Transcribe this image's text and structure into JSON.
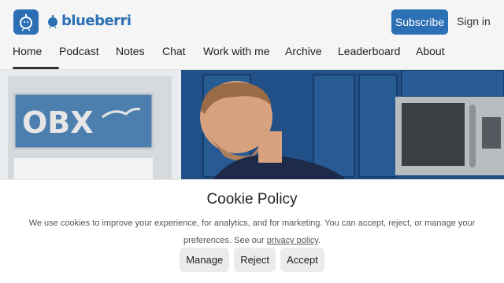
{
  "brand": {
    "name": "blueberri",
    "accent": "#2b6fb4"
  },
  "header": {
    "subscribe_label": "Subscribe",
    "signin_label": "Sign in"
  },
  "nav": {
    "items": [
      {
        "label": "Home",
        "active": true
      },
      {
        "label": "Podcast"
      },
      {
        "label": "Notes"
      },
      {
        "label": "Chat"
      },
      {
        "label": "Work with me"
      },
      {
        "label": "Archive"
      },
      {
        "label": "Leaderboard"
      },
      {
        "label": "About"
      }
    ]
  },
  "hero": {
    "sign_text": "OBX"
  },
  "cookie": {
    "title": "Cookie Policy",
    "text_line1": "We use cookies to improve your experience, for analytics, and for marketing. You can accept, reject, or manage your",
    "text_line2_prefix": "preferences. See our ",
    "privacy_link": "privacy policy",
    "text_line2_suffix": ".",
    "manage_label": "Manage",
    "reject_label": "Reject",
    "accept_label": "Accept"
  }
}
